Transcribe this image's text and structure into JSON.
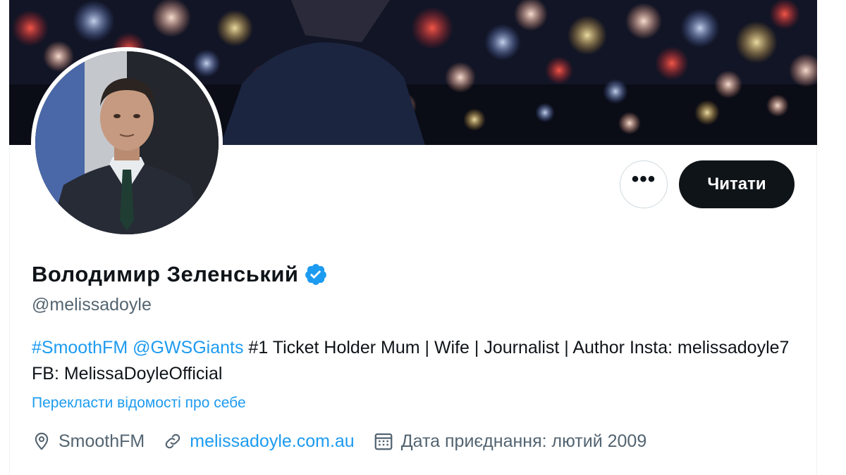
{
  "profile": {
    "display_name": "Володимир Зеленський",
    "handle": "@melissadoyle",
    "verified": true,
    "bio": {
      "tag1": "#SmoothFM",
      "tag2": "@GWSGiants",
      "text": " #1 Ticket Holder Mum | Wife | Journalist | Author Insta: melissadoyle7 FB: MelissaDoyleOfficial"
    },
    "translate_label": "Перекласти відомості про себе",
    "location": "SmoothFM",
    "website": "melissadoyle.com.au",
    "joined": "Дата приєднання: лютий 2009"
  },
  "actions": {
    "more_label": "•••",
    "follow_label": "Читати"
  },
  "icons": {
    "more": "more-icon",
    "verified": "verified-badge-icon",
    "location": "location-pin-icon",
    "link": "link-icon",
    "calendar": "calendar-icon"
  },
  "colors": {
    "accent": "#1d9bf0",
    "text_primary": "#0f1419",
    "text_secondary": "#536471",
    "button_dark": "#0f1419"
  }
}
